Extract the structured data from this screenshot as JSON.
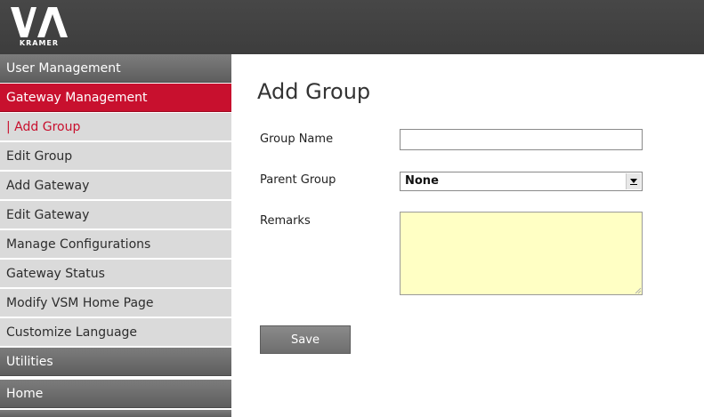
{
  "brand": {
    "logo_text": "KRAMER",
    "logo_mark": "VIA",
    "colors": {
      "topbar": "#404040",
      "accent": "#c8102e",
      "nav_dark": "#6b6b6b",
      "nav_sub": "#dadada",
      "remarks_bg": "#ffffc4"
    }
  },
  "sidebar": {
    "items": [
      {
        "label": "User Management"
      },
      {
        "label": "Gateway Management"
      },
      {
        "label": "| Add Group"
      },
      {
        "label": "Edit Group"
      },
      {
        "label": "Add Gateway"
      },
      {
        "label": "Edit Gateway"
      },
      {
        "label": "Manage Configurations"
      },
      {
        "label": "Gateway Status"
      },
      {
        "label": "Modify VSM Home Page"
      },
      {
        "label": "Customize Language"
      },
      {
        "label": "Utilities"
      },
      {
        "label": "Home"
      }
    ]
  },
  "main": {
    "title": "Add Group",
    "form": {
      "group_name_label": "Group Name",
      "group_name_value": "",
      "parent_group_label": "Parent Group",
      "parent_group_value": "None",
      "remarks_label": "Remarks",
      "remarks_value": "",
      "save_label": "Save"
    }
  }
}
